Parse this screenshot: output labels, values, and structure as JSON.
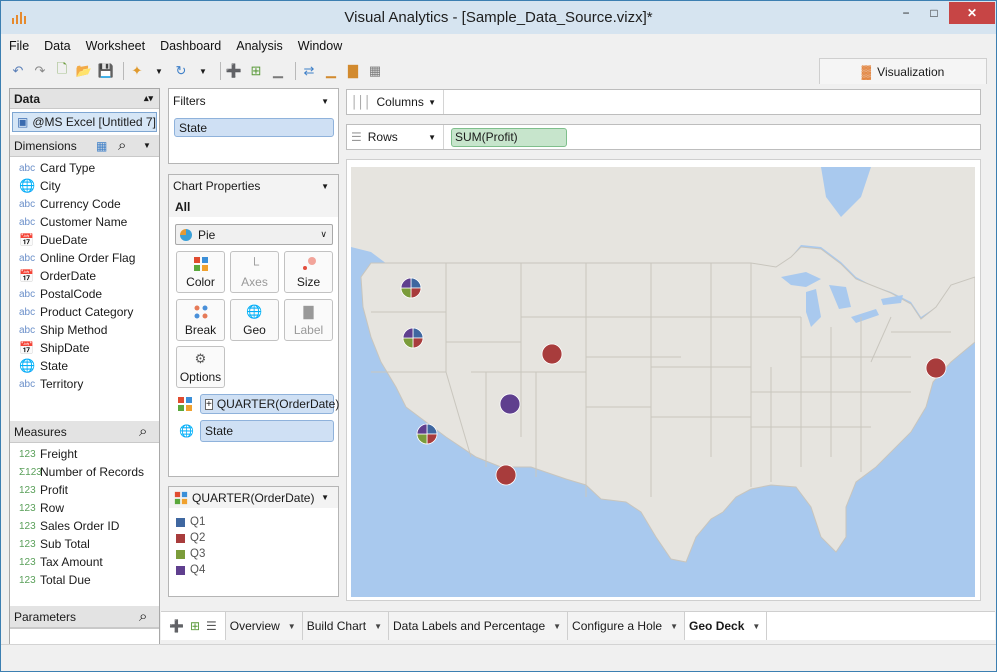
{
  "window": {
    "title": "Visual Analytics - [Sample_Data_Source.vizx]*",
    "min": "−",
    "max": "□",
    "close": "✕"
  },
  "menu": [
    "File",
    "Data",
    "Worksheet",
    "Dashboard",
    "Analysis",
    "Window"
  ],
  "viz_tab": {
    "label": "Visualization"
  },
  "data_panel": {
    "header": "Data",
    "datasource": "@MS Excel [Untitled 7]",
    "dimensions_header": "Dimensions",
    "dimensions": [
      {
        "type": "abc",
        "name": "Card Type"
      },
      {
        "type": "globe",
        "name": "City"
      },
      {
        "type": "abc",
        "name": "Currency Code"
      },
      {
        "type": "abc",
        "name": "Customer Name"
      },
      {
        "type": "date",
        "name": "DueDate"
      },
      {
        "type": "abc",
        "name": "Online Order Flag"
      },
      {
        "type": "date",
        "name": "OrderDate"
      },
      {
        "type": "abc",
        "name": "PostalCode"
      },
      {
        "type": "abc",
        "name": "Product Category"
      },
      {
        "type": "abc",
        "name": "Ship Method"
      },
      {
        "type": "date",
        "name": "ShipDate"
      },
      {
        "type": "globe",
        "name": "State"
      },
      {
        "type": "abc",
        "name": "Territory"
      }
    ],
    "measures_header": "Measures",
    "measures": [
      {
        "type": "123",
        "name": "Freight"
      },
      {
        "type": "Σ123",
        "name": "Number of Records"
      },
      {
        "type": "123",
        "name": "Profit"
      },
      {
        "type": "123",
        "name": "Row"
      },
      {
        "type": "123",
        "name": "Sales Order ID"
      },
      {
        "type": "123",
        "name": "Sub Total"
      },
      {
        "type": "123",
        "name": "Tax Amount"
      },
      {
        "type": "123",
        "name": "Total Due"
      }
    ],
    "parameters_header": "Parameters"
  },
  "filters": {
    "header": "Filters",
    "items": [
      "State"
    ]
  },
  "chart_properties": {
    "header": "Chart Properties",
    "scope": "All",
    "chart_type": "Pie",
    "buttons": {
      "color": "Color",
      "axes": "Axes",
      "size": "Size",
      "break": "Break",
      "geo": "Geo",
      "label": "Label",
      "options": "Options"
    },
    "color_field": "QUARTER(OrderDate)",
    "geo_field": "State",
    "expand": "+"
  },
  "legend": {
    "header": "QUARTER(OrderDate)",
    "items": [
      {
        "label": "Q1",
        "color": "#3f67a0"
      },
      {
        "label": "Q2",
        "color": "#a83c3c"
      },
      {
        "label": "Q3",
        "color": "#7b9c3a"
      },
      {
        "label": "Q4",
        "color": "#5f3f8e"
      }
    ]
  },
  "shelves": {
    "columns": "Columns",
    "rows": "Rows",
    "rows_pill": "SUM(Profit)"
  },
  "sheet_tabs": [
    {
      "label": "Overview",
      "active": false
    },
    {
      "label": "Build Chart",
      "active": false
    },
    {
      "label": "Data Labels and Percentage",
      "active": false
    },
    {
      "label": "Configure a Hole",
      "active": false
    },
    {
      "label": "Geo Deck",
      "active": true
    }
  ],
  "chart_data": {
    "type": "pie",
    "title": "",
    "map": "USA states",
    "color_by": "QUARTER(OrderDate)",
    "size_by": "SUM(Profit)",
    "series": [
      "Q1",
      "Q2",
      "Q3",
      "Q4"
    ],
    "pies": [
      {
        "state": "Washington",
        "slices": [
          0.25,
          0.25,
          0.25,
          0.25
        ]
      },
      {
        "state": "Oregon",
        "slices": [
          0.25,
          0.25,
          0.25,
          0.25
        ]
      },
      {
        "state": "California",
        "slices": [
          0.25,
          0.25,
          0.25,
          0.25
        ]
      },
      {
        "state": "Utah",
        "slices": [
          0,
          0,
          0,
          1
        ]
      },
      {
        "state": "Arizona",
        "slices": [
          0,
          1,
          0,
          0
        ]
      },
      {
        "state": "Wyoming",
        "slices": [
          0,
          1,
          0,
          0
        ]
      },
      {
        "state": "New York",
        "slices": [
          0,
          1,
          0,
          0
        ]
      }
    ]
  }
}
